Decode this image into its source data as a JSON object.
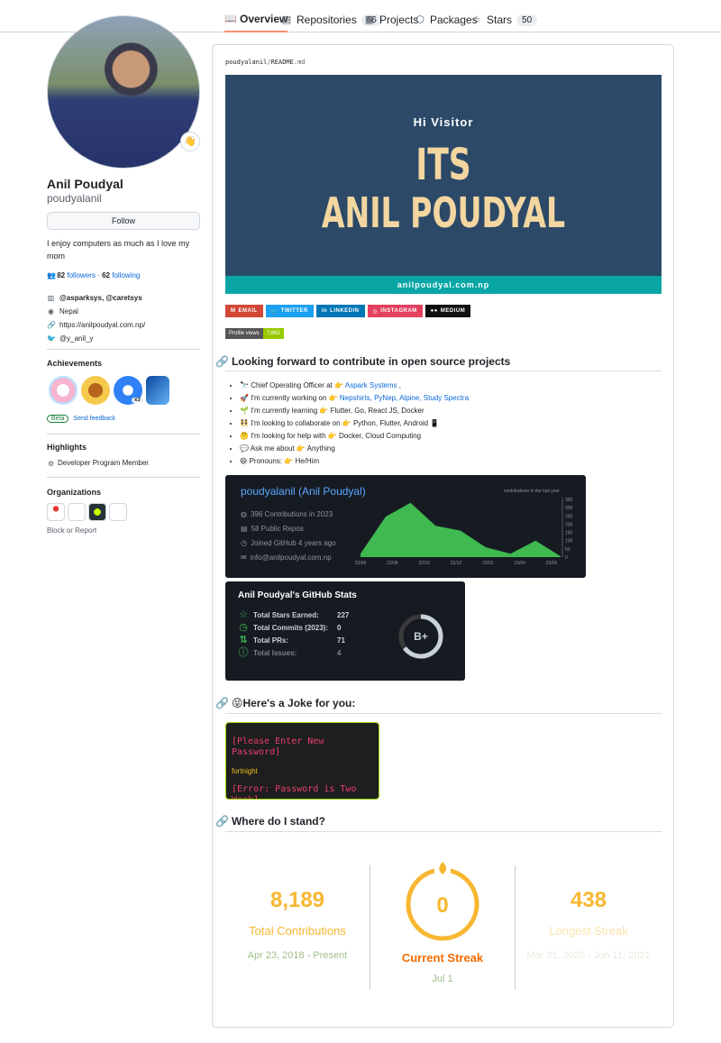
{
  "nav": {
    "tabs": [
      {
        "label": "Overview",
        "icon": "book-icon"
      },
      {
        "label": "Repositories",
        "count": "66",
        "icon": "repo-icon"
      },
      {
        "label": "Projects",
        "icon": "project-icon"
      },
      {
        "label": "Packages",
        "icon": "package-icon"
      },
      {
        "label": "Stars",
        "count": "50",
        "icon": "star-icon"
      }
    ]
  },
  "profile": {
    "status_emoji": "👋",
    "fullname": "Anil Poudyal",
    "login": "poudyalanil",
    "follow_label": "Follow",
    "bio": "I enjoy computers as much as I love my mom",
    "followers_count": "82",
    "followers_label": "followers",
    "separator": "·",
    "following_count": "62",
    "following_label": "following",
    "orgs": "@asparksys, @caretsys",
    "location": "Nepal",
    "website": "https://anilpoudyal.com.np/",
    "twitter": "@y_anil_y"
  },
  "achievements": {
    "title": "Achievements",
    "x3": "x3",
    "beta": "Beta",
    "feedback": "Send feedback"
  },
  "highlights": {
    "title": "Highlights",
    "item": "Developer Program Member"
  },
  "organizations": {
    "title": "Organizations",
    "block": "Block or Report"
  },
  "readme": {
    "path_user": "poudyalanil",
    "path_sep": "/",
    "path_file": "README",
    "path_ext": ".md",
    "banner": {
      "hi": "Hi Visitor",
      "its": "ITS",
      "name": "ANIL POUDYAL",
      "site": "anilpoudyal.com.np"
    },
    "socials": [
      {
        "label": "EMAIL",
        "color": "#d14836"
      },
      {
        "label": "TWITTER",
        "color": "#1ca0f1"
      },
      {
        "label": "LINKEDIN",
        "color": "#0077b5"
      },
      {
        "label": "INSTAGRAM",
        "color": "#e4405f"
      },
      {
        "label": "MEDIUM",
        "color": "#12100e"
      }
    ],
    "profile_views_label": "Profile views",
    "profile_views_value": "7,662",
    "heading1": "Looking forward to contribute in open source projects",
    "bullets": [
      {
        "emoji": "🔭",
        "pre": "Chief Operating Officer at 👉 ",
        "link": "Aspark Systems",
        "post": " ,"
      },
      {
        "emoji": "🚀",
        "pre": "I'm currently working on 👉 ",
        "link": "Nepshirts, PyNep, Alpine, Study Spectra",
        "post": ""
      },
      {
        "emoji": "🌱",
        "pre": "I'm currently learning 👉 Flutter, Go, React JS, Docker",
        "link": "",
        "post": ""
      },
      {
        "emoji": "👯",
        "pre": "I'm looking to collaborate on 👉 Python, Flutter, Android 📱",
        "link": "",
        "post": ""
      },
      {
        "emoji": "🤔",
        "pre": "I'm looking for help with 👉 Docker, Cloud Computing",
        "link": "",
        "post": ""
      },
      {
        "emoji": "💬",
        "pre": "Ask me about 👉 Anything",
        "link": "",
        "post": ""
      },
      {
        "emoji": "😄",
        "pre": "Pronouns: 👉 He/Him",
        "link": "",
        "post": ""
      }
    ],
    "contrib_card": {
      "title": "poudyalanil (Anil Poudyal)",
      "contributions": "396 Contributions in 2023",
      "repos": "58 Public Repos",
      "joined": "Joined GitHub 4 years ago",
      "email": "info@anilpoudyal.com.np",
      "chart_caption": "contributions in the last year"
    },
    "chart_data": {
      "type": "area",
      "x": [
        "22/06",
        "22/08",
        "22/10",
        "22/12",
        "23/02",
        "23/04",
        "23/06"
      ],
      "values": [
        20,
        245,
        330,
        190,
        160,
        60,
        20,
        100,
        5
      ],
      "yticks": [
        "0",
        "50",
        "100",
        "150",
        "200",
        "250",
        "300",
        "350"
      ],
      "ylim": [
        0,
        350
      ],
      "color": "#3fb950"
    },
    "gh_stats": {
      "title": "Anil Poudyal's GitHub Stats",
      "rows": [
        {
          "label": "Total Stars Earned:",
          "value": "227",
          "icon": "star-icon"
        },
        {
          "label": "Total Commits (2023):",
          "value": "0",
          "icon": "clock-icon"
        },
        {
          "label": "Total PRs:",
          "value": "71",
          "icon": "pr-icon"
        },
        {
          "label": "Total Issues:",
          "value": "4",
          "icon": "issue-icon"
        }
      ],
      "grade": "B+"
    },
    "heading2": "😝Here's a Joke for you:",
    "joke": {
      "question": "[Please Enter New Password]",
      "answer": "fortnight",
      "error": "[Error: Password is Two Weak]"
    },
    "heading3": "Where do I stand?",
    "streak": {
      "total": "8,189",
      "total_label": "Total Contributions",
      "total_range": "Apr 23, 2018 - Present",
      "current": "0",
      "current_label": "Current Streak",
      "current_date": "Jul 1",
      "longest": "438",
      "longest_label": "Longest Streak",
      "longest_range": "Mar 31, 2020 - Jun 11, 2021"
    }
  }
}
